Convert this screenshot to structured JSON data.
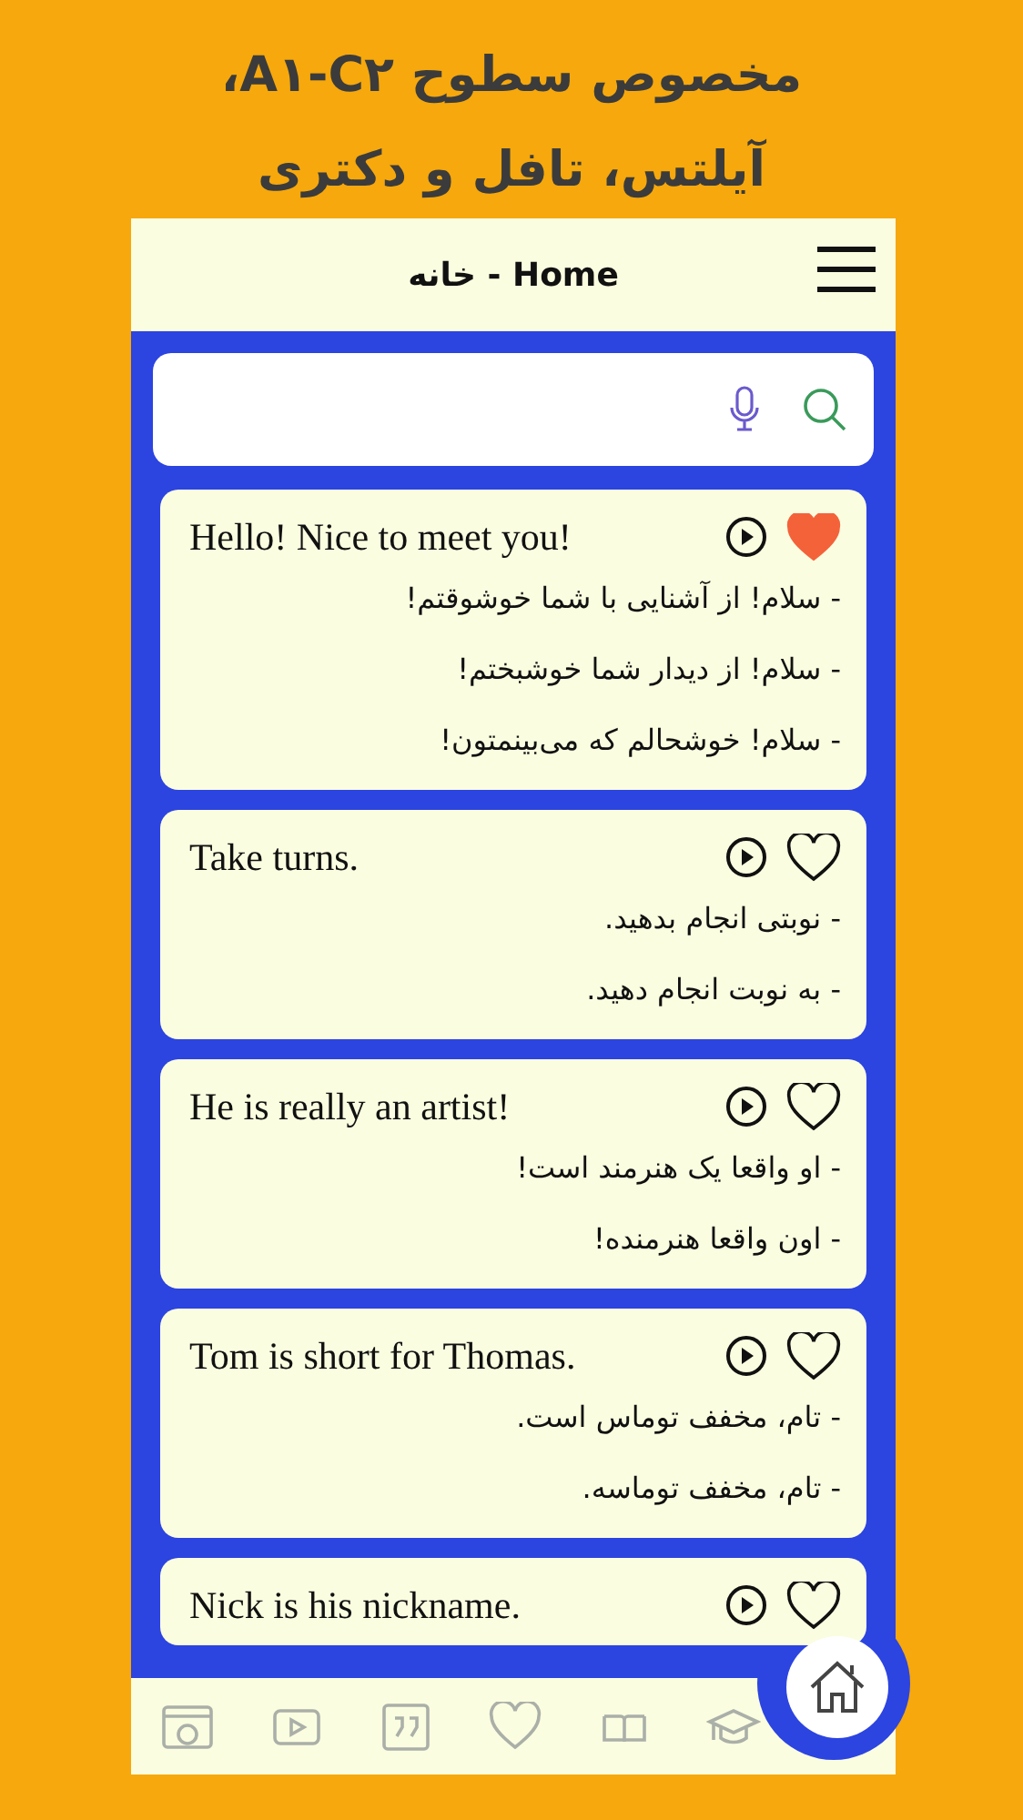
{
  "headline": [
    "مخصوص سطوح A۱-C۲،",
    "آیلتس، تافل و دکتری"
  ],
  "header": {
    "title": "خانه - Home"
  },
  "cards": [
    {
      "phrase": "Hello! Nice to meet you!",
      "favorite": true,
      "translations": [
        "- سلام! از آشنایی با شما خوشوقتم!",
        "- سلام! از دیدار شما خوشبختم!",
        "- سلام! خوشحالم که می‌بینمتون!"
      ]
    },
    {
      "phrase": "Take turns.",
      "favorite": false,
      "translations": [
        "- نوبتی انجام بدهید.",
        "- به نوبت انجام دهید."
      ]
    },
    {
      "phrase": "He is really an artist!",
      "favorite": false,
      "translations": [
        "- او واقعا یک هنرمند است!",
        "- اون واقعا هنرمنده!"
      ]
    },
    {
      "phrase": "Tom is short for Thomas.",
      "favorite": false,
      "translations": [
        "- تام، مخفف توماس است.",
        "- تام، مخفف توماسه."
      ]
    },
    {
      "phrase": "Nick is his nickname.",
      "favorite": false
    }
  ],
  "nav": [
    {
      "kind": "ads",
      "selected": false
    },
    {
      "kind": "video",
      "selected": false
    },
    {
      "kind": "quote",
      "selected": false
    },
    {
      "kind": "favorites",
      "selected": false
    },
    {
      "kind": "book",
      "selected": false
    },
    {
      "kind": "course",
      "selected": false
    },
    {
      "kind": "home",
      "selected": true
    }
  ]
}
